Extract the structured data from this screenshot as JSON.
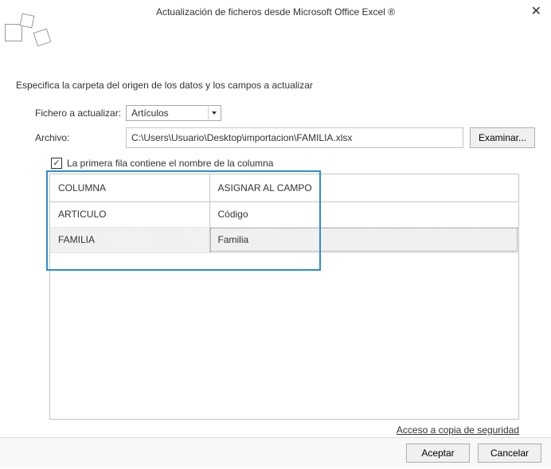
{
  "title": "Actualización de ficheros desde Microsoft Office Excel ®",
  "intro": "Especifica la carpeta del origen de los datos y los campos a actualizar",
  "labels": {
    "file_to_update": "Fichero a actualizar:",
    "file_path": "Archivo:",
    "browse": "Examinar...",
    "first_row_header": "La primera fila contiene el nombre de la columna"
  },
  "select": {
    "value": "Artículos"
  },
  "path": {
    "value": "C:\\Users\\Usuario\\Desktop\\importacion\\FAMILIA.xlsx"
  },
  "table": {
    "headers": {
      "col1": "COLUMNA",
      "col2": "ASIGNAR AL CAMPO"
    },
    "rows": [
      {
        "col1": "ARTICULO",
        "col2": "Código"
      },
      {
        "col1": "FAMILIA",
        "col2": "Familia"
      }
    ]
  },
  "backup_link": "Acceso a copia de seguridad",
  "buttons": {
    "accept": "Aceptar",
    "cancel": "Cancelar"
  }
}
